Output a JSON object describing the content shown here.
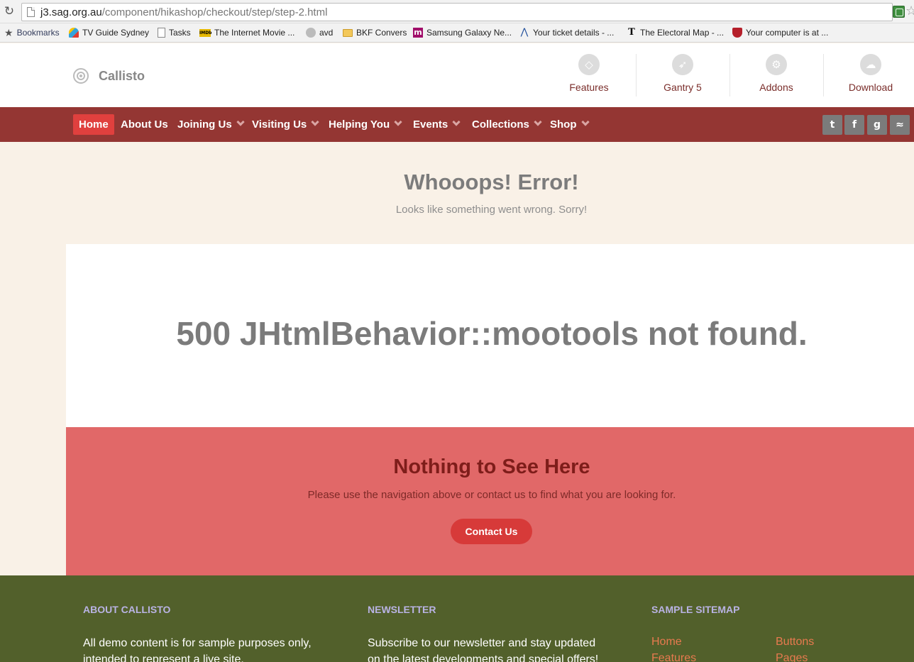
{
  "browser": {
    "url_host": "j3.sag.org.au",
    "url_path": "/component/hikashop/checkout/step/step-2.html",
    "bookmarks": [
      {
        "label": "Bookmarks",
        "icon": "star-icon"
      },
      {
        "label": "TV Guide Sydney",
        "icon": "tv-guide-icon"
      },
      {
        "label": "Tasks",
        "icon": "page-icon"
      },
      {
        "label": "The Internet Movie ...",
        "icon": "imdb-icon"
      },
      {
        "label": "avd",
        "icon": "avd-icon"
      },
      {
        "label": "BKF Convers",
        "icon": "folder-icon"
      },
      {
        "label": "Samsung Galaxy Ne...",
        "icon": "m-icon"
      },
      {
        "label": "Your ticket details - ...",
        "icon": "ticket-icon"
      },
      {
        "label": "The Electoral Map - ...",
        "icon": "nyt-icon"
      },
      {
        "label": "Your computer is at ...",
        "icon": "shield-icon"
      }
    ]
  },
  "header": {
    "logo": "Callisto",
    "top_links": [
      {
        "label": "Features",
        "icon": "diamond-icon"
      },
      {
        "label": "Gantry 5",
        "icon": "rocket-icon"
      },
      {
        "label": "Addons",
        "icon": "gear-icon"
      },
      {
        "label": "Download",
        "icon": "cloud-download-icon"
      }
    ]
  },
  "nav": {
    "items": [
      {
        "label": "Home",
        "active": true,
        "dropdown": false
      },
      {
        "label": "About Us",
        "active": false,
        "dropdown": false
      },
      {
        "label": "Joining Us",
        "active": false,
        "dropdown": true
      },
      {
        "label": "Visiting Us",
        "active": false,
        "dropdown": true
      },
      {
        "label": "Helping You",
        "active": false,
        "dropdown": true
      },
      {
        "label": "Events",
        "active": false,
        "dropdown": true
      },
      {
        "label": "Collections",
        "active": false,
        "dropdown": true
      },
      {
        "label": "Shop",
        "active": false,
        "dropdown": true
      }
    ],
    "social": [
      {
        "icon": "twitter-icon",
        "glyph": "t"
      },
      {
        "icon": "facebook-icon",
        "glyph": "f"
      },
      {
        "icon": "google-icon",
        "glyph": "g"
      },
      {
        "icon": "rss-icon",
        "glyph": "≈"
      }
    ]
  },
  "error": {
    "title": "Whooops! Error!",
    "subtitle": "Looks like something went wrong. Sorry!",
    "message": "500 JHtmlBehavior::mootools not found."
  },
  "nothing": {
    "title": "Nothing to See Here",
    "subtitle": "Please use the navigation above or contact us to find what you are looking for.",
    "button": "Contact Us"
  },
  "footer": {
    "about_heading": "ABOUT CALLISTO",
    "about_text": "All demo content is for sample purposes only, intended to represent a live site.",
    "newsletter_heading": "NEWSLETTER",
    "newsletter_text": "Subscribe to our newsletter and stay updated on the latest developments and special offers!",
    "sitemap_heading": "SAMPLE SITEMAP",
    "sitemap_col1": [
      "Home",
      "Features"
    ],
    "sitemap_col2": [
      "Buttons",
      "Pages"
    ]
  },
  "colors": {
    "nav_bg": "#943633",
    "accent_red": "#e0403e",
    "error_panel": "#e16868",
    "footer_bg": "#52602b",
    "link_orange": "#e87a4f"
  }
}
